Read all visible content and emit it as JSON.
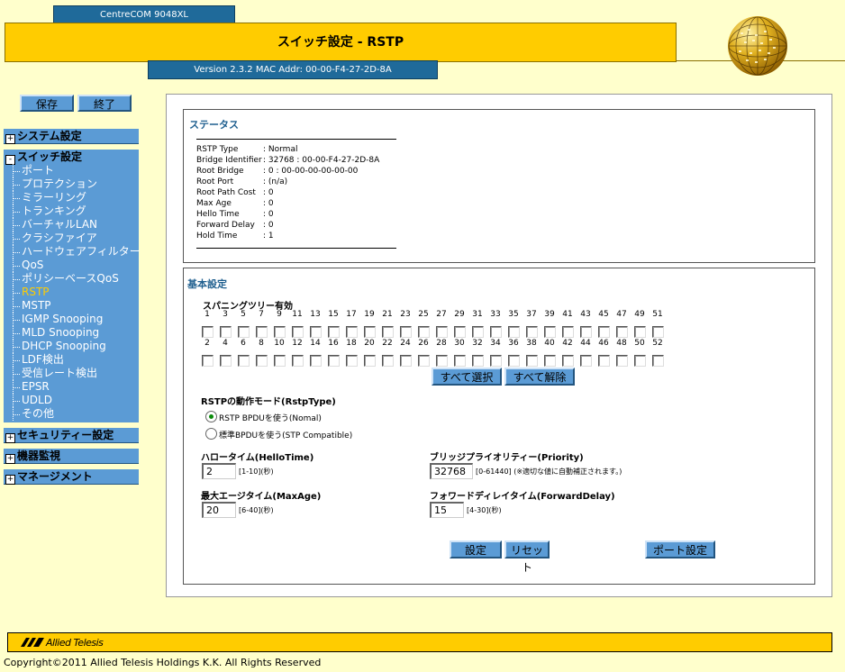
{
  "header": {
    "model": "CentreCOM 9048XL",
    "title": "スイッチ設定 - RSTP",
    "version": "Version 2.3.2 MAC Addr: 00-00-F4-27-2D-8A"
  },
  "top_buttons": {
    "save": "保存",
    "exit": "終了"
  },
  "sidebar": {
    "system": "システム設定",
    "switch": "スイッチ設定",
    "switch_items": [
      "ポート",
      "プロテクション",
      "ミラーリング",
      "トランキング",
      "バーチャルLAN",
      "クラシファイア",
      "ハードウェアフィルター",
      "QoS",
      "ポリシーベースQoS",
      "RSTP",
      "MSTP",
      "IGMP Snooping",
      "MLD Snooping",
      "DHCP Snooping",
      "LDF検出",
      "受信レート検出",
      "EPSR",
      "UDLD",
      "その他"
    ],
    "active_item": "RSTP",
    "security": "セキュリティー設定",
    "monitor": "機器監視",
    "management": "マネージメント",
    "plus": "+",
    "minus": "-"
  },
  "status": {
    "title": "ステータス",
    "rows": [
      {
        "label": "RSTP Type",
        "value": ": Normal"
      },
      {
        "label": "Bridge Identifier",
        "value": ": 32768 : 00-00-F4-27-2D-8A"
      },
      {
        "label": "Root Bridge",
        "value": ": 0 : 00-00-00-00-00-00"
      },
      {
        "label": "Root Port",
        "value": ": (n/a)"
      },
      {
        "label": "Root Path Cost",
        "value": ": 0"
      },
      {
        "label": "Max Age",
        "value": ": 0"
      },
      {
        "label": "Hello Time",
        "value": ": 0"
      },
      {
        "label": "Forward Delay",
        "value": ": 0"
      },
      {
        "label": "Hold Time",
        "value": ": 1"
      }
    ]
  },
  "basic": {
    "title": "基本設定",
    "spanning_label": "スパニングツリー有効",
    "odd_ports": [
      "1",
      "3",
      "5",
      "7",
      "9",
      "11",
      "13",
      "15",
      "17",
      "19",
      "21",
      "23",
      "25",
      "27",
      "29",
      "31",
      "33",
      "35",
      "37",
      "39",
      "41",
      "43",
      "45",
      "47",
      "49",
      "51"
    ],
    "even_ports": [
      "2",
      "4",
      "6",
      "8",
      "10",
      "12",
      "14",
      "16",
      "18",
      "20",
      "22",
      "24",
      "26",
      "28",
      "30",
      "32",
      "34",
      "36",
      "38",
      "40",
      "42",
      "44",
      "46",
      "48",
      "50",
      "52"
    ],
    "select_all": "すべて選択",
    "deselect_all": "すべて解除",
    "mode_label": "RSTPの動作モード(RstpType)",
    "mode_normal": "RSTP BPDUを使う(Nomal)",
    "mode_stp": "標準BPDUを使う(STP Compatible)",
    "hello_label": "ハロータイム(HelloTime)",
    "hello_value": "2",
    "hello_range": "[1-10](秒)",
    "maxage_label": "最大エージタイム(MaxAge)",
    "maxage_value": "20",
    "maxage_range": "[6-40](秒)",
    "priority_label": "ブリッジプライオリティー(Priority)",
    "priority_value": "32768",
    "priority_range": "[0-61440] (※適切な値に自動補正されます。)",
    "fwd_label": "フォワードディレイタイム(ForwardDelay)",
    "fwd_value": "15",
    "fwd_range": "[4-30](秒)",
    "apply": "設定",
    "reset": "リセット",
    "port_settings": "ポート設定"
  },
  "footer": {
    "logo": "Allied Telesis",
    "copyright": "Copyright©2011 Allied Telesis Holdings K.K. All Rights Reserved"
  },
  "colors": {
    "gold": "#ffcc00",
    "blue": "#5b9bd5",
    "navy": "#1f6a9a",
    "bg": "#ffffcc"
  }
}
